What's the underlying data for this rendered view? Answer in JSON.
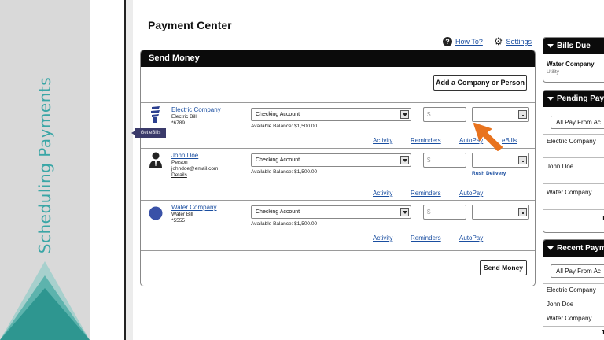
{
  "slide": {
    "title": "Scheduling Payments"
  },
  "header": {
    "title": "Payment Center",
    "help_label": "How To?",
    "settings_label": "Settings"
  },
  "send_money": {
    "title": "Send Money",
    "add_label": "Add a Company or Person",
    "send_label": "Send Money",
    "get_ebills_label": "Get eBills",
    "payees": [
      {
        "name": "Electric Company",
        "line1": "Electric Bill",
        "line2": "*6789",
        "account": "Checking Account",
        "balance": "Available Balance: $1,500.00",
        "amount_placeholder": "$",
        "links": [
          "Activity",
          "Reminders",
          "AutoPay",
          "eBills"
        ]
      },
      {
        "name": "John Doe",
        "line1": "Person",
        "line2": "johndoe@email.com",
        "details": "Details",
        "account": "Checking Account",
        "balance": "Available Balance: $1,500.00",
        "amount_placeholder": "$",
        "rush": "Rush Delivery",
        "links": [
          "Activity",
          "Reminders",
          "AutoPay"
        ]
      },
      {
        "name": "Water Company",
        "line1": "Water Bill",
        "line2": "*5555",
        "account": "Checking Account",
        "balance": "Available Balance: $1,500.00",
        "amount_placeholder": "$",
        "links": [
          "Activity",
          "Reminders",
          "AutoPay"
        ]
      }
    ]
  },
  "bills_due": {
    "title": "Bills Due",
    "item_name": "Water Company",
    "item_sub": "Utility"
  },
  "pending": {
    "title": "Pending Paym",
    "filter": "All Pay From Ac",
    "items": [
      "Electric Company",
      "John Doe",
      "Water Company"
    ],
    "footer": "T"
  },
  "recent": {
    "title": "Recent Payme",
    "filter": "All Pay From Ac",
    "items": [
      "Electric Company",
      "John Doe",
      "Water Company"
    ],
    "footer": "T"
  },
  "colors": {
    "accent_teal": "#3aa6a6",
    "link_blue": "#1a4ea0",
    "header_black": "#0b0b0b",
    "cursor_orange": "#e8731e"
  }
}
